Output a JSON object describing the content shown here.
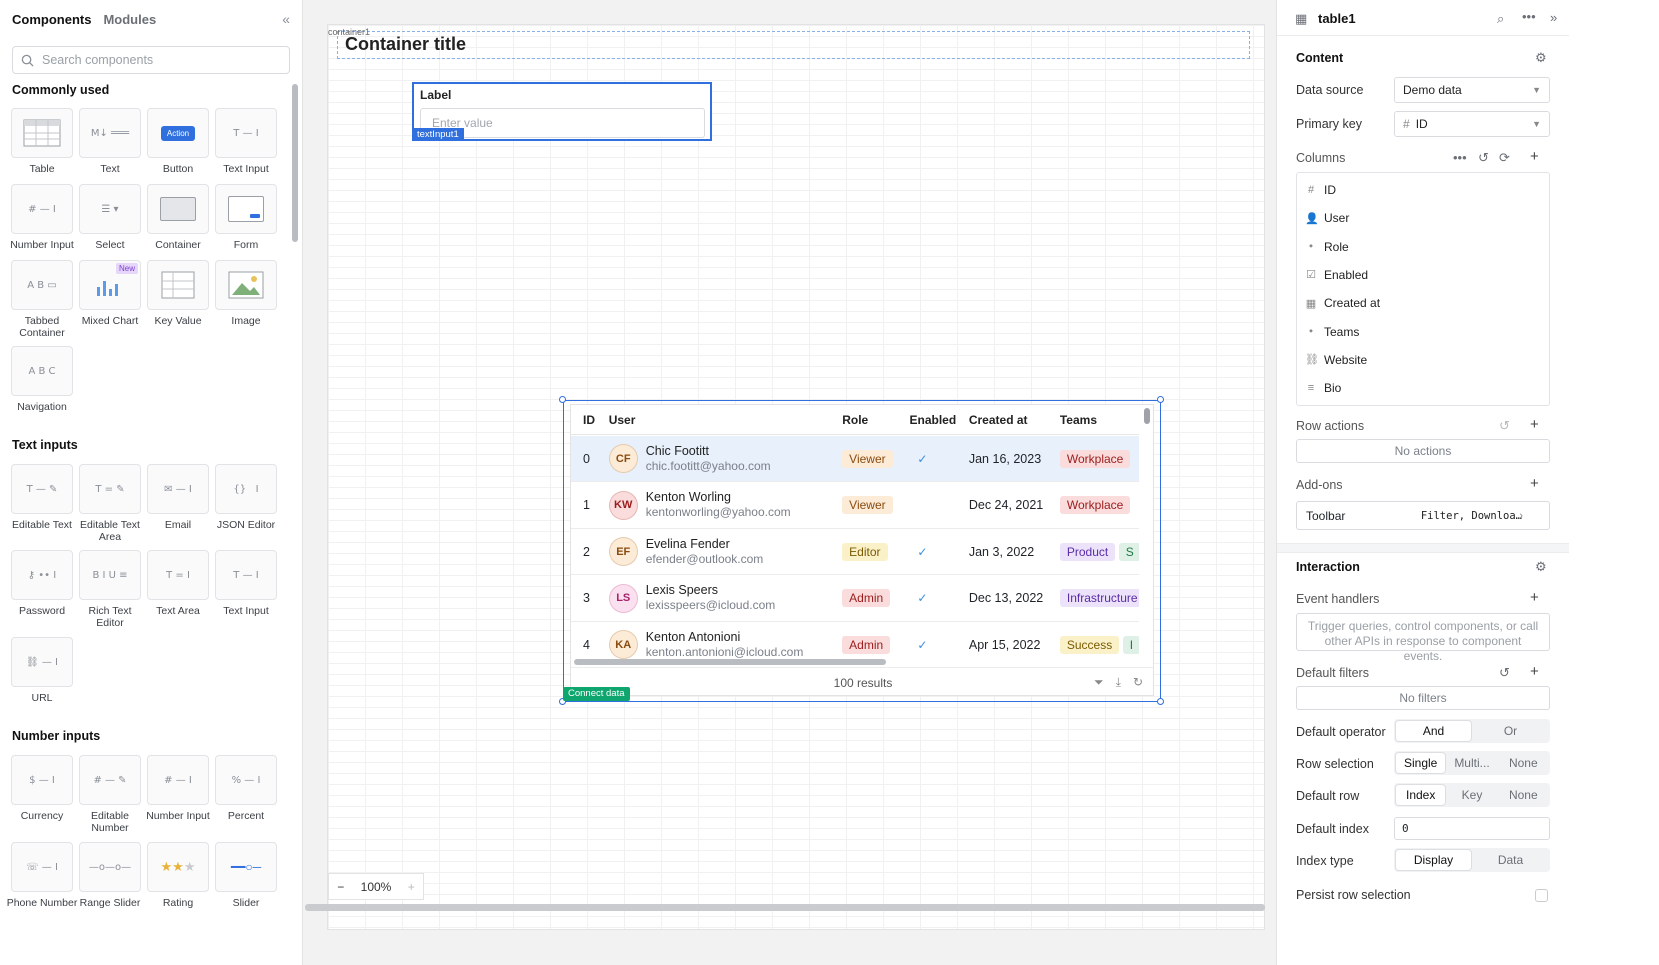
{
  "left_panel": {
    "tabs": [
      "Components",
      "Modules"
    ],
    "search_placeholder": "Search components",
    "sections": {
      "commonly_used": "Commonly used",
      "text_inputs": "Text inputs",
      "number_inputs": "Number inputs"
    },
    "commonly_used": [
      "Table",
      "Text",
      "Button",
      "Text Input",
      "Number Input",
      "Select",
      "Container",
      "Form",
      "Tabbed Container",
      "Mixed Chart",
      "Key Value",
      "Image",
      "Navigation"
    ],
    "button_glyph": "Action",
    "new_badge": "New",
    "text_inputs": [
      "Editable Text",
      "Editable Text Area",
      "Email",
      "JSON Editor",
      "Password",
      "Rich Text Editor",
      "Text Area",
      "Text Input",
      "URL"
    ],
    "number_inputs": [
      "Currency",
      "Editable Number",
      "Number Input",
      "Percent",
      "Phone Number",
      "Range Slider",
      "Rating",
      "Slider"
    ]
  },
  "canvas": {
    "container_tag": "container1",
    "container_title": "Container title",
    "text_input": {
      "label": "Label",
      "placeholder": "Enter value",
      "tag": "textInput1"
    },
    "connect_data": "Connect data",
    "zoom": "100%",
    "table": {
      "columns": [
        "ID",
        "User",
        "Role",
        "Enabled",
        "Created at",
        "Teams"
      ],
      "rows": [
        {
          "id": "0",
          "initials": "CF",
          "name": "Chic Footitt",
          "email": "chic.footitt@yahoo.com",
          "role": "Viewer",
          "enabled": true,
          "created": "Jan 16, 2023",
          "team": "Workplace",
          "team2": ""
        },
        {
          "id": "1",
          "initials": "KW",
          "name": "Kenton Worling",
          "email": "kentonworling@yahoo.com",
          "role": "Viewer",
          "enabled": false,
          "created": "Dec 24, 2021",
          "team": "Workplace",
          "team2": ""
        },
        {
          "id": "2",
          "initials": "EF",
          "name": "Evelina Fender",
          "email": "efender@outlook.com",
          "role": "Editor",
          "enabled": true,
          "created": "Jan 3, 2022",
          "team": "Product",
          "team2": "S"
        },
        {
          "id": "3",
          "initials": "LS",
          "name": "Lexis Speers",
          "email": "lexisspeers@icloud.com",
          "role": "Admin",
          "enabled": true,
          "created": "Dec 13, 2022",
          "team": "Infrastructure",
          "team2": ""
        },
        {
          "id": "4",
          "initials": "KA",
          "name": "Kenton Antonioni",
          "email": "kenton.antonioni@icloud.com",
          "role": "Admin",
          "enabled": true,
          "created": "Apr 15, 2022",
          "team": "Success",
          "team2": "I"
        }
      ],
      "footer": "100 results"
    }
  },
  "right_panel": {
    "title": "table1",
    "content_section": "Content",
    "data_source_label": "Data source",
    "data_source_value": "Demo data",
    "primary_key_label": "Primary key",
    "primary_key_value": "ID",
    "columns_label": "Columns",
    "columns": [
      {
        "name": "ID",
        "icon": "hash-icon"
      },
      {
        "name": "User",
        "icon": "user-icon"
      },
      {
        "name": "Role",
        "icon": "tag-icon"
      },
      {
        "name": "Enabled",
        "icon": "checkbox-icon"
      },
      {
        "name": "Created at",
        "icon": "calendar-icon"
      },
      {
        "name": "Teams",
        "icon": "tags-icon"
      },
      {
        "name": "Website",
        "icon": "link-icon"
      },
      {
        "name": "Bio",
        "icon": "paragraph-icon"
      }
    ],
    "row_actions_label": "Row actions",
    "row_actions_empty": "No actions",
    "addons_label": "Add-ons",
    "toolbar_label": "Toolbar",
    "toolbar_value": "Filter, Downloa…",
    "interaction_section": "Interaction",
    "event_handlers_label": "Event handlers",
    "event_handlers_placeholder": "Trigger queries, control components, or call other APIs in response to component events.",
    "default_filters_label": "Default filters",
    "default_filters_empty": "No filters",
    "default_operator_label": "Default operator",
    "default_operator_options": [
      "And",
      "Or"
    ],
    "row_selection_label": "Row selection",
    "row_selection_options": [
      "Single",
      "Multi...",
      "None"
    ],
    "default_row_label": "Default row",
    "default_row_options": [
      "Index",
      "Key",
      "None"
    ],
    "default_index_label": "Default index",
    "default_index_value": "0",
    "index_type_label": "Index type",
    "index_type_options": [
      "Display",
      "Data"
    ],
    "persist_label": "Persist row selection"
  },
  "colors": {
    "selection_blue": "#2f6fde",
    "connect_green": "#0ea66e"
  }
}
